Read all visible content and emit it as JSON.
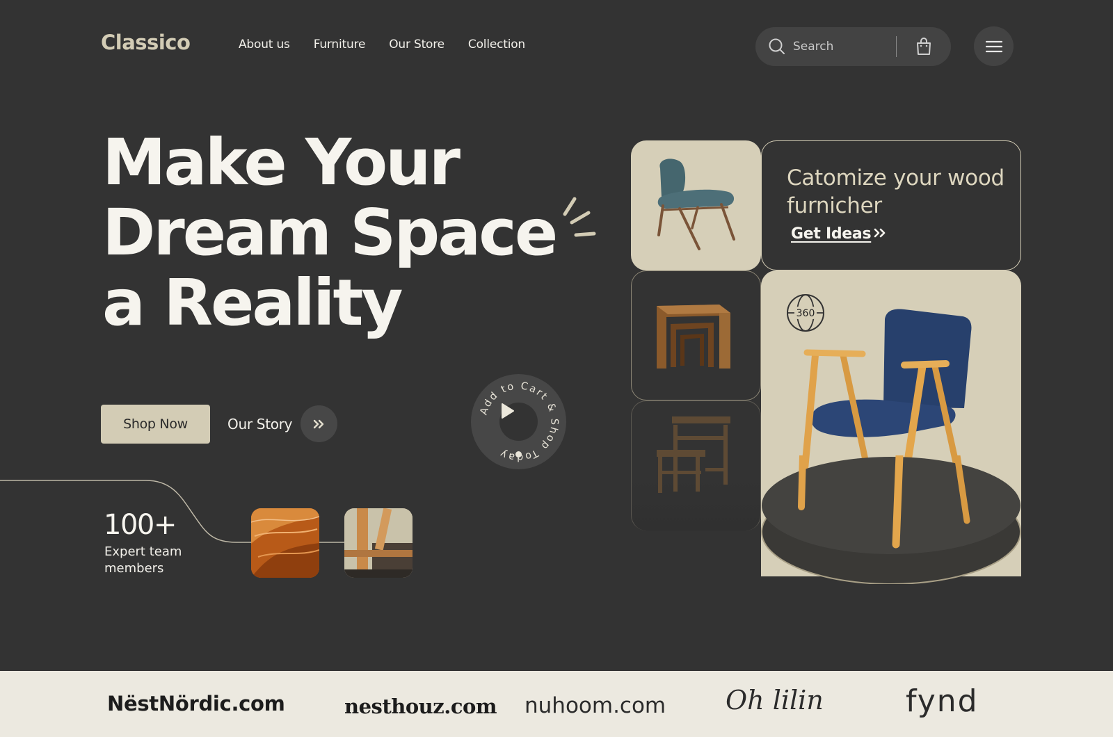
{
  "header": {
    "logo": "Classico",
    "nav": [
      "About us",
      "Furniture",
      "Our Store",
      "Collection"
    ],
    "search_placeholder": "Search"
  },
  "hero": {
    "title_lines": [
      "Make Your",
      "Dream Space",
      "a Reality"
    ],
    "shop_now": "Shop Now",
    "our_story": "Our Story",
    "badge_text": "Add to Cart & Shop Today"
  },
  "stats": {
    "number": "100+",
    "label": "Expert team members"
  },
  "showcase": {
    "customize_text": "Catomize your wood furnicher",
    "get_ideas": "Get Ideas",
    "view_360": "360"
  },
  "brands": [
    "NëstNördic.com",
    "nesthouz.com",
    "nuhoom.com",
    "Oh lilin",
    "fynd"
  ],
  "colors": {
    "background": "#333333",
    "accent_beige": "#d3ccb5",
    "panel": "#d6cfb8",
    "text_light": "#f6f4ee",
    "strip": "#ece9e0"
  }
}
